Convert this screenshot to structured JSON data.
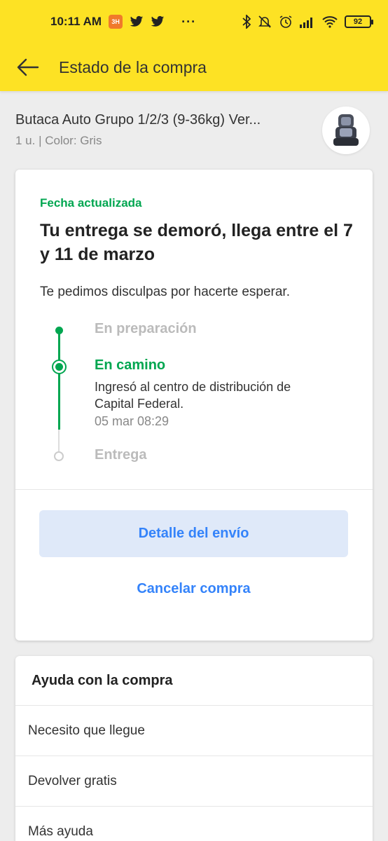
{
  "status_bar": {
    "time": "10:11 AM",
    "notification_badge": "3H",
    "more": "···",
    "battery": "92"
  },
  "header": {
    "title": "Estado de la compra",
    "accent_color": "#fde224"
  },
  "product": {
    "title": "Butaca Auto Grupo 1/2/3 (9-36kg) Ver...",
    "details": "1 u. | Color: Gris"
  },
  "shipment": {
    "status_label": "Fecha actualizada",
    "headline": "Tu entrega se demoró, llega entre el 7 y 11 de marzo",
    "apology": "Te pedimos disculpas por hacerte esperar.",
    "steps": [
      {
        "label": "En preparación",
        "state": "done"
      },
      {
        "label": "En camino",
        "state": "current",
        "description": "Ingresó al centro de distribución de Capital Federal.",
        "timestamp": "05 mar 08:29"
      },
      {
        "label": "Entrega",
        "state": "pending"
      }
    ],
    "detail_button": "Detalle del envío",
    "cancel_button": "Cancelar compra",
    "status_color": "#00a650",
    "link_color": "#3483fa"
  },
  "help": {
    "title": "Ayuda con la compra",
    "items": [
      {
        "label": "Necesito que llegue"
      },
      {
        "label": "Devolver gratis"
      },
      {
        "label": "Más ayuda"
      }
    ]
  }
}
